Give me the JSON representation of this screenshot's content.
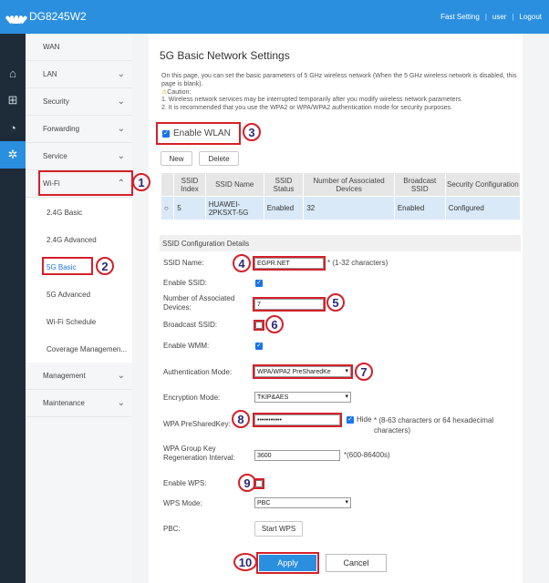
{
  "app": {
    "logo_text": "DG8245W2"
  },
  "topnav": {
    "fast_setting": "Fast Setting",
    "user": "user",
    "logout": "Logout",
    "sep": "|"
  },
  "sidebar": {
    "wan": "WAN",
    "lan": "LAN",
    "security": "Security",
    "forwarding": "Forwarding",
    "service": "Service",
    "wifi": "Wi-Fi",
    "wifi_sub": [
      "2.4G Basic",
      "2.4G Advanced",
      "5G Basic",
      "5G Advanced",
      "Wi-Fi Schedule",
      "Coverage Managemen..."
    ],
    "management": "Management",
    "maintenance": "Maintenance"
  },
  "page": {
    "title": "5G Basic Network Settings",
    "desc1": "On this page, you can set the basic parameters of 5 GHz wireless network (When the 5 GHz wireless network is disabled, this page is blank).",
    "caution": "Caution:",
    "caution1": "1. Wireless network services may be interrupted temporarily after you modify wireless network parameters.",
    "caution2": "2. It is recommended that you use the WPA2 or WPA/WPA2 authentication mode for security purposes.",
    "enable_wlan": "Enable WLAN",
    "new_btn": "New",
    "delete_btn": "Delete"
  },
  "table": {
    "headers": [
      "SSID Index",
      "SSID Name",
      "SSID Status",
      "Number of Associated Devices",
      "Broadcast SSID",
      "Security Configuration"
    ],
    "row": [
      "5",
      "HUAWEI-2PKSXT-5G",
      "Enabled",
      "32",
      "Enabled",
      "Configured"
    ]
  },
  "config": {
    "section_title": "SSID Configuration Details",
    "ssid_name_label": "SSID Name:",
    "ssid_name_value": "EGPR.NET",
    "ssid_name_hint": "* (1-32 characters)",
    "enable_ssid_label": "Enable SSID:",
    "num_devices_label": "Number of Associated Devices:",
    "num_devices_value": "7",
    "broadcast_label": "Broadcast SSID:",
    "wmm_label": "Enable WMM:",
    "auth_label": "Authentication Mode:",
    "auth_value": "WPA/WPA2 PreSharedKe",
    "enc_label": "Encryption Mode:",
    "enc_value": "TKIP&AES",
    "psk_label": "WPA PreSharedKey:",
    "psk_value": "•••••••••••",
    "hide_label": "Hide",
    "psk_hint": "* (8-63 characters or 64 hexadecimal characters)",
    "rekey_label": "WPA Group Key Regeneration Interval:",
    "rekey_value": "3600",
    "rekey_hint": "*(600-86400s)",
    "wps_label": "Enable WPS:",
    "wps_mode_label": "WPS Mode:",
    "wps_mode_value": "PBC",
    "pbc_label": "PBC:",
    "start_wps": "Start WPS"
  },
  "actions": {
    "apply": "Apply",
    "cancel": "Cancel"
  },
  "badges": [
    "1",
    "2",
    "3",
    "4",
    "5",
    "6",
    "7",
    "8",
    "9",
    "10"
  ],
  "colors": {
    "topbar": "#2b8fe0",
    "annotation": "#d4202a",
    "iconbar": "#1e2c3a"
  }
}
